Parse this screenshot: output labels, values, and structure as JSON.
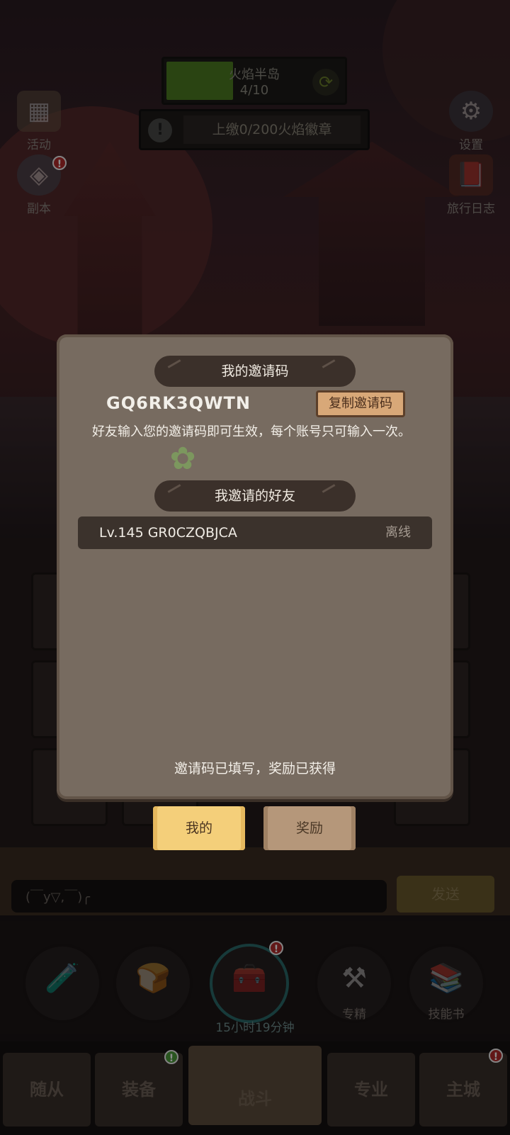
{
  "hud": {
    "region_name": "火焰半岛",
    "region_progress": "4/10",
    "region_progress_fraction": 0.4,
    "quest_text": "上缴0/200火焰徽章",
    "left_buttons": [
      {
        "label": "活动",
        "icon": "calendar-icon"
      },
      {
        "label": "副本",
        "icon": "dungeon-icon"
      }
    ],
    "right_buttons": [
      {
        "label": "设置",
        "icon": "gear-icon"
      },
      {
        "label": "旅行日志",
        "icon": "book-icon"
      }
    ]
  },
  "chat": {
    "input_text": "(￣y▽,￣)╭",
    "send_label": "发送"
  },
  "actions": {
    "specialty_label": "专精",
    "skillbook_label": "技能书",
    "chest_timer": "15小时19分钟"
  },
  "nav": {
    "tabs": [
      "随从",
      "装备",
      "战斗",
      "专业",
      "主城"
    ]
  },
  "dialog": {
    "my_code_title": "我的邀请码",
    "invite_code": "GQ6RK3QWTN",
    "copy_button": "复制邀请码",
    "hint": "好友输入您的邀请码即可生效，每个账号只可输入一次。",
    "friends_title": "我邀请的好友",
    "friends": [
      {
        "name": "Lv.145 GR0CZQBJCA",
        "status": "离线"
      }
    ],
    "footer": "邀请码已填写，奖励已获得",
    "sub_tabs": {
      "mine": "我的",
      "rewards": "奖励"
    }
  },
  "colors": {
    "accent_active_tab": "#f4cf7a",
    "dialog_bg": "#776b60",
    "ribbon_bg": "#3b302a",
    "progress_green": "#4d7d21"
  }
}
